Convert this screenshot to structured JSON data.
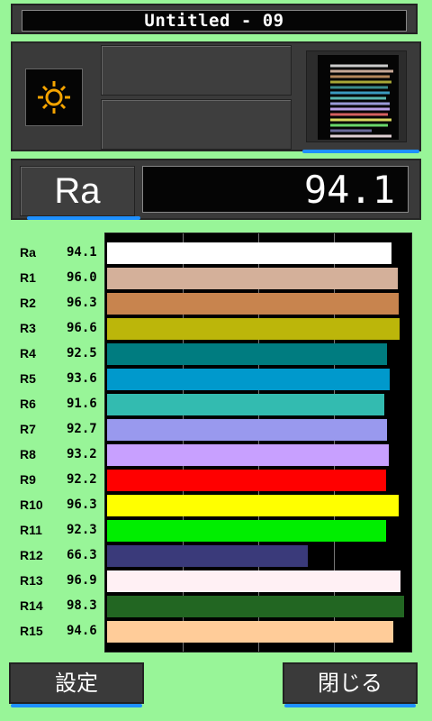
{
  "title": "Untitled - 09",
  "ra": {
    "label": "Ra",
    "value": "94.1"
  },
  "icons": {
    "light_source": "sun-icon",
    "spectrum_thumbnail": "spectrum-thumbnail-icon"
  },
  "buttons": {
    "settings": "設定",
    "close": "閉じる"
  },
  "chart_data": {
    "type": "bar",
    "orientation": "horizontal",
    "categories": [
      "Ra",
      "R1",
      "R2",
      "R3",
      "R4",
      "R5",
      "R6",
      "R7",
      "R8",
      "R9",
      "R10",
      "R11",
      "R12",
      "R13",
      "R14",
      "R15"
    ],
    "values": [
      94.1,
      96.0,
      96.3,
      96.6,
      92.5,
      93.6,
      91.6,
      92.7,
      93.2,
      92.2,
      96.3,
      92.3,
      66.3,
      96.9,
      98.3,
      94.6
    ],
    "value_labels": [
      "94.1",
      "96.0",
      "96.3",
      "96.6",
      "92.5",
      "93.6",
      "91.6",
      "92.7",
      "93.2",
      "92.2",
      "96.3",
      "92.3",
      "66.3",
      "96.9",
      "98.3",
      "94.6"
    ],
    "colors": [
      "#ffffff",
      "#d4b09a",
      "#c8844e",
      "#bcb60a",
      "#007c80",
      "#0099cc",
      "#33bbb0",
      "#9999ee",
      "#c8a0ff",
      "#ff0000",
      "#ffff00",
      "#00ee00",
      "#3a3a7a",
      "#fff0f4",
      "#226622",
      "#ffcc99"
    ],
    "xlim": [
      0,
      100
    ],
    "grid": true
  }
}
